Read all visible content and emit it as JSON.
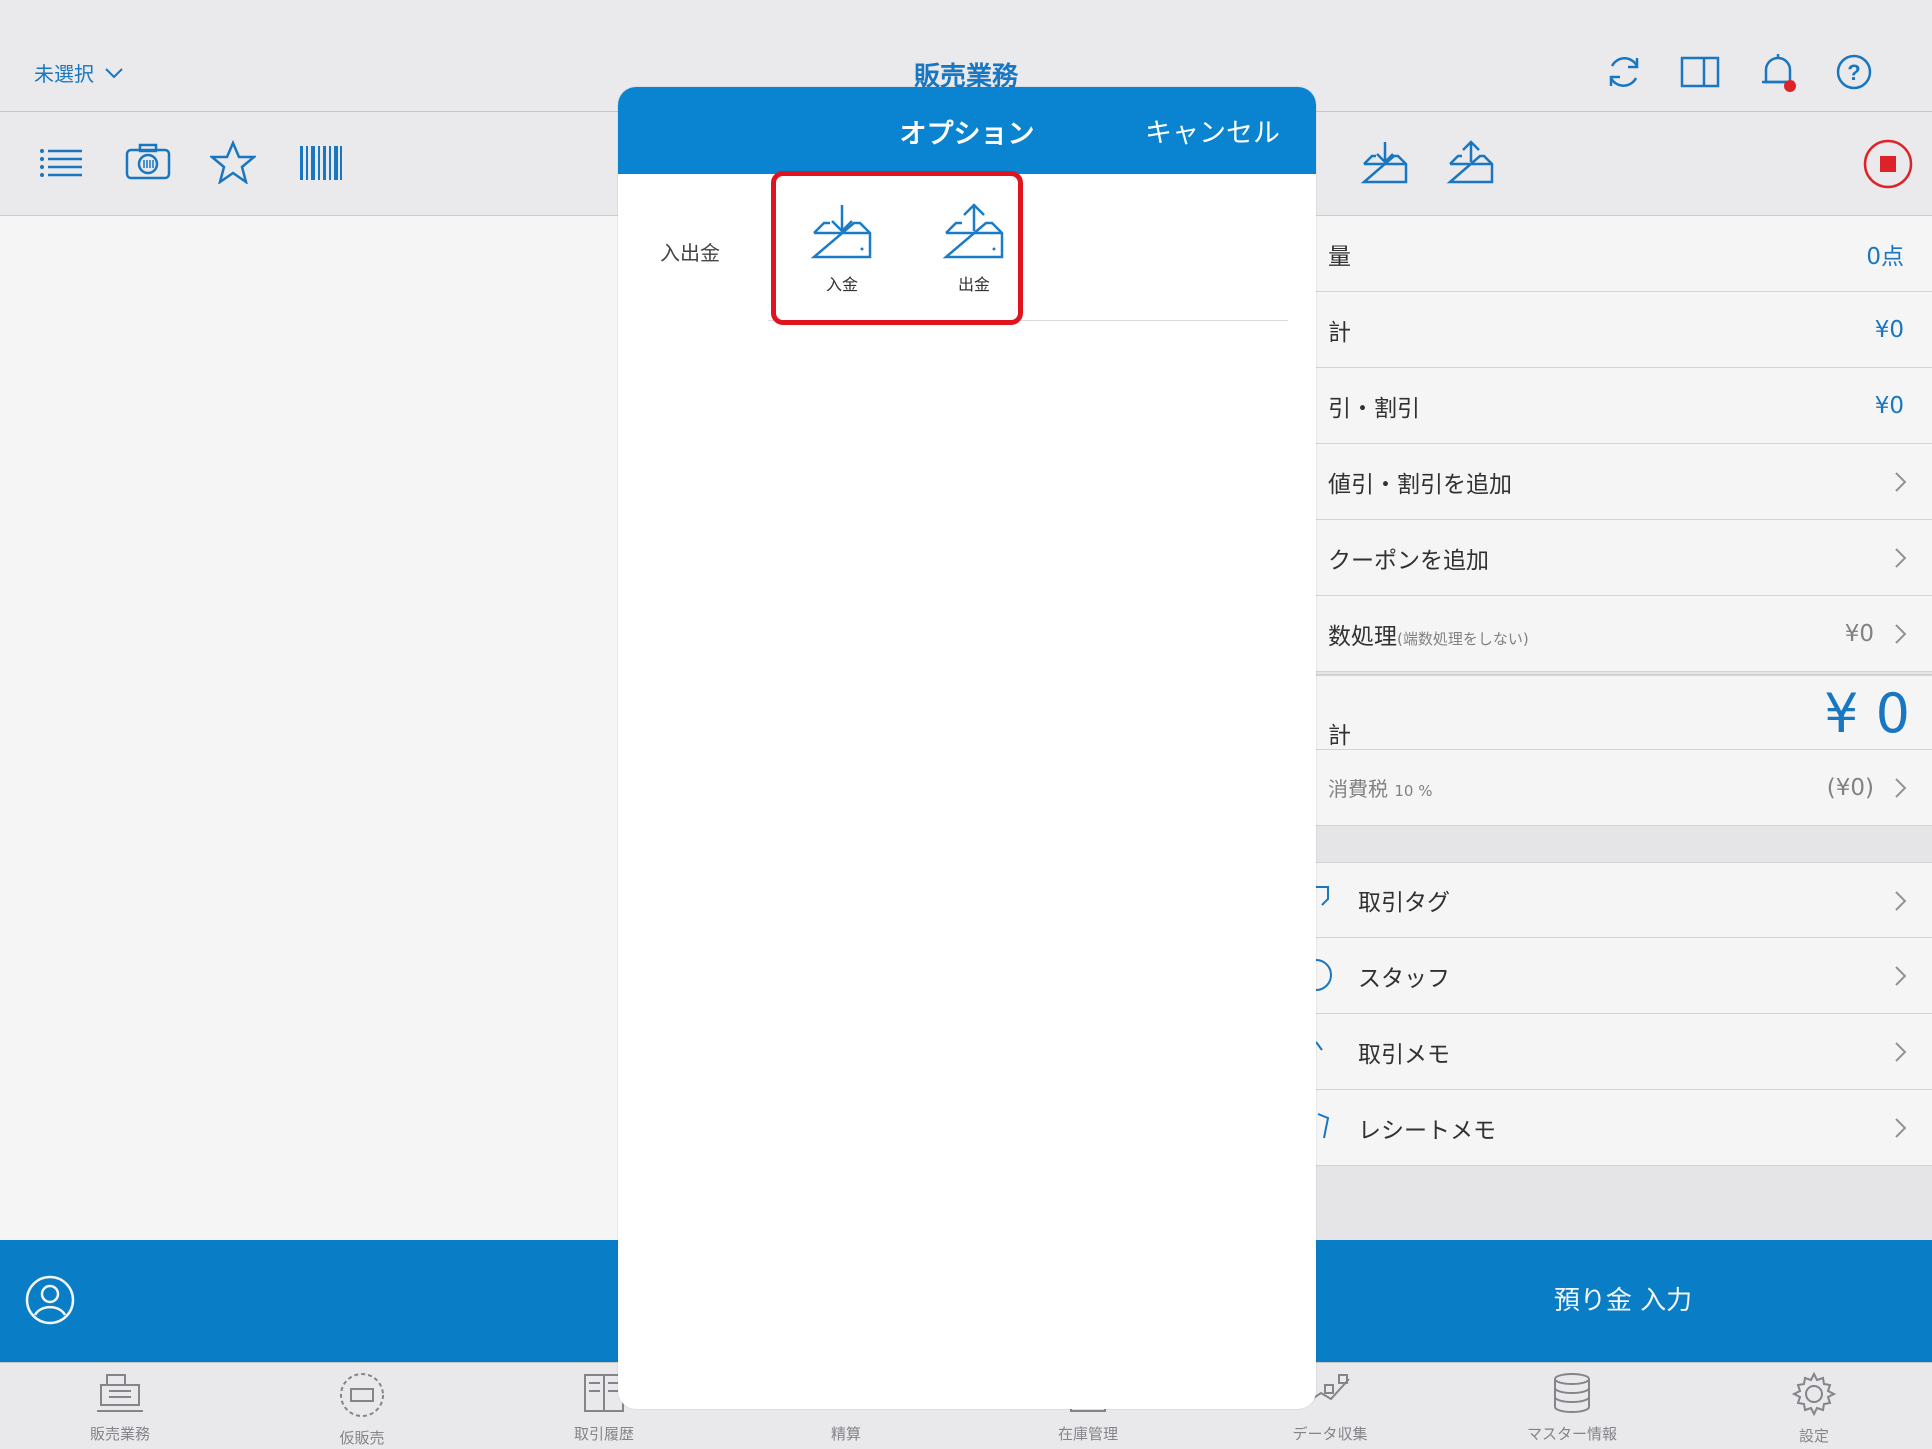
{
  "header": {
    "store_selector": "未選択",
    "title": "販売業務"
  },
  "summary": {
    "rows": [
      {
        "label": "量",
        "value": "0点"
      },
      {
        "label": "計",
        "value": "¥0"
      },
      {
        "label": "引・割引",
        "value": "¥0"
      },
      {
        "label": "値引・割引を追加"
      },
      {
        "label": "クーポンを追加"
      },
      {
        "label": "数処理",
        "note": "(端数処理をしない)",
        "value": "¥0"
      },
      {
        "label": "計",
        "value": "¥ 0"
      },
      {
        "label": "消費税",
        "note": "10 %",
        "value": "(¥0)"
      }
    ],
    "links": [
      "取引タグ",
      "スタッフ",
      "取引メモ",
      "レシートメモ"
    ]
  },
  "footer": {
    "deposit_label": "預り金 入力"
  },
  "tabs": [
    "販売業務",
    "仮販売",
    "取引履歴",
    "精算",
    "在庫管理",
    "データ収集",
    "マスター情報",
    "設定"
  ],
  "modal": {
    "title": "オプション",
    "cancel": "キャンセル",
    "section_label": "入出金",
    "options": [
      "入金",
      "出金"
    ]
  },
  "colors": {
    "accent": "#0a84d0",
    "highlight": "#e0141e",
    "stop": "#e8252a"
  }
}
